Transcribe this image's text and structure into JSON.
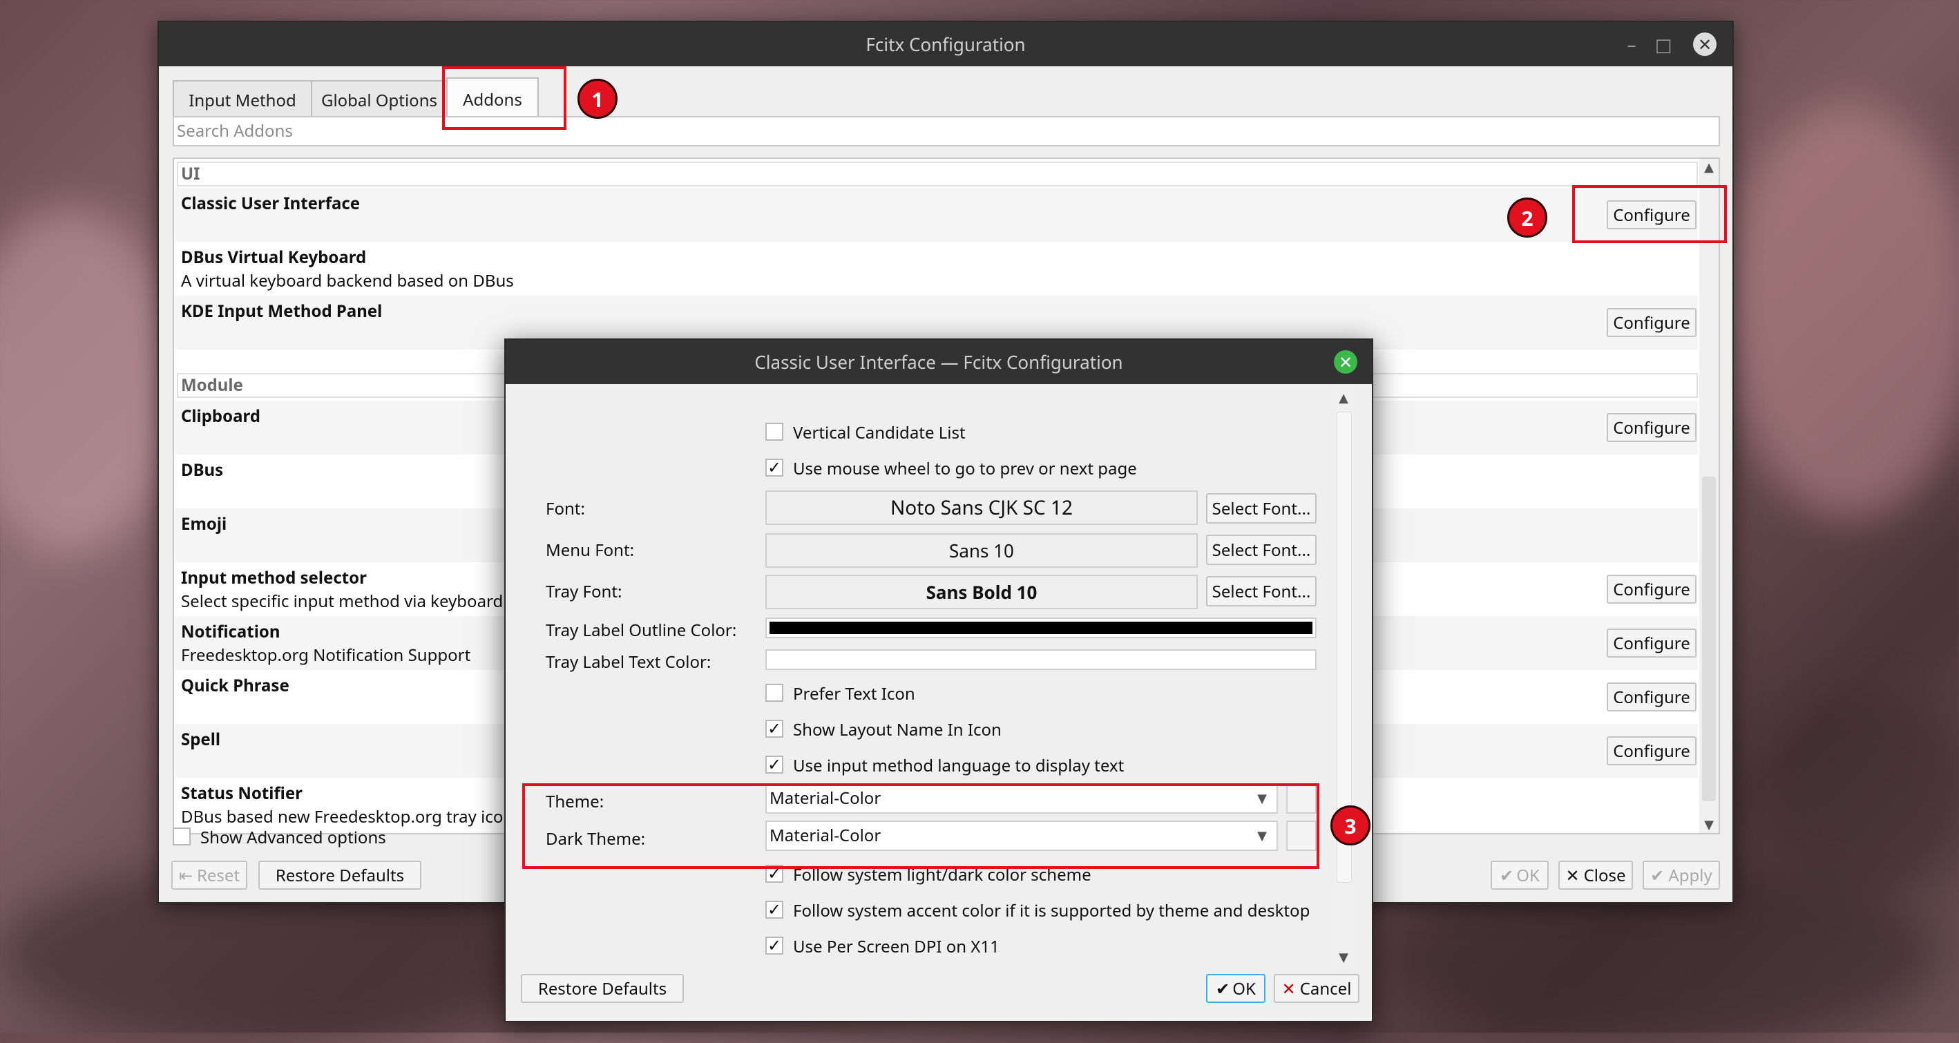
{
  "main_window": {
    "title": "Fcitx Configuration",
    "tabs": [
      "Input Method",
      "Global Options",
      "Addons"
    ],
    "search_placeholder": "Search Addons",
    "categories": {
      "ui": "UI",
      "module": "Module"
    },
    "addons": [
      {
        "name": "Classic User Interface",
        "desc": "",
        "configure": "Configure"
      },
      {
        "name": "DBus Virtual Keyboard",
        "desc": "A virtual keyboard backend based on DBus",
        "configure": ""
      },
      {
        "name": "KDE Input Method Panel",
        "desc": "",
        "configure": "Configure"
      },
      {
        "name": "Clipboard",
        "desc": "",
        "configure": "Configure"
      },
      {
        "name": "DBus",
        "desc": "",
        "configure": ""
      },
      {
        "name": "Emoji",
        "desc": "",
        "configure": ""
      },
      {
        "name": "Input method selector",
        "desc": "Select specific input method via keyboard",
        "configure": "Configure"
      },
      {
        "name": "Notification",
        "desc": "Freedesktop.org Notification Support",
        "configure": "Configure"
      },
      {
        "name": "Quick Phrase",
        "desc": "",
        "configure": "Configure"
      },
      {
        "name": "Spell",
        "desc": "",
        "configure": "Configure"
      },
      {
        "name": "Status Notifier",
        "desc": "DBus based new Freedesktop.org tray icon",
        "configure": ""
      }
    ],
    "show_advanced": "Show Advanced options",
    "buttons": {
      "reset": "Reset",
      "restore_defaults": "Restore Defaults",
      "ok": "OK",
      "close": "Close",
      "apply": "Apply"
    }
  },
  "dialog": {
    "title": "Classic User Interface — Fcitx Configuration",
    "options": {
      "vertical_candidate_list": {
        "label": "Vertical Candidate List",
        "checked": false
      },
      "mouse_wheel": {
        "label": "Use mouse wheel to go to prev or next page",
        "checked": true
      },
      "prefer_text_icon": {
        "label": "Prefer Text Icon",
        "checked": false
      },
      "show_layout_name": {
        "label": "Show Layout Name In Icon",
        "checked": true
      },
      "use_im_language": {
        "label": "Use input method language to display text",
        "checked": true
      },
      "follow_system_scheme": {
        "label": "Follow system light/dark color scheme",
        "checked": true
      },
      "follow_accent": {
        "label": "Follow system accent color if it is supported by theme and desktop",
        "checked": true
      },
      "per_screen_dpi": {
        "label": "Use Per Screen DPI on X11",
        "checked": true
      }
    },
    "fonts": {
      "font_label": "Font:",
      "font_value": "Noto Sans CJK SC 12",
      "menu_font_label": "Menu Font:",
      "menu_font_value": "Sans 10",
      "tray_font_label": "Tray Font:",
      "tray_font_value": "Sans Bold 10",
      "select_font": "Select Font..."
    },
    "colors": {
      "outline_label": "Tray Label Outline Color:",
      "outline_color": "#000000",
      "text_label": "Tray Label Text Color:",
      "text_color": "#ffffff"
    },
    "theme": {
      "label": "Theme:",
      "value": "Material-Color"
    },
    "dark_theme": {
      "label": "Dark Theme:",
      "value": "Material-Color"
    },
    "buttons": {
      "restore_defaults": "Restore Defaults",
      "ok": "OK",
      "cancel": "Cancel"
    }
  },
  "annotations": [
    "1",
    "2",
    "3"
  ],
  "colors": {
    "highlight": "#e0121f",
    "titlebar": "#323232"
  }
}
